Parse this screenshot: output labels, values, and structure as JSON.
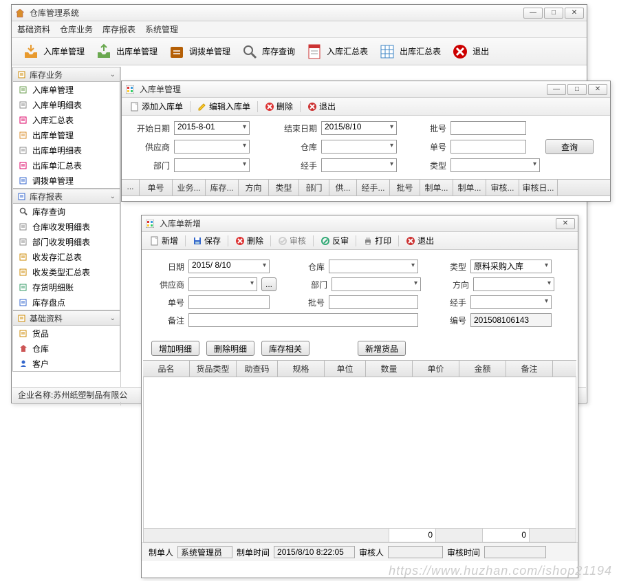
{
  "main": {
    "title": "仓库管理系统",
    "menu": [
      "基础资料",
      "仓库业务",
      "库存报表",
      "系统管理"
    ],
    "toolbar": [
      {
        "label": "入库单管理",
        "icon": "inbox",
        "color": "#e89a2e"
      },
      {
        "label": "出库单管理",
        "icon": "outbox",
        "color": "#6aa84f"
      },
      {
        "label": "调拨单管理",
        "icon": "transfer",
        "color": "#b45f06"
      },
      {
        "label": "库存查询",
        "icon": "search",
        "color": "#666"
      },
      {
        "label": "入库汇总表",
        "icon": "sheet",
        "color": "#cc3333"
      },
      {
        "label": "出库汇总表",
        "icon": "grid",
        "color": "#3d85c6"
      },
      {
        "label": "退出",
        "icon": "close",
        "color": "#cc0000"
      }
    ],
    "accordion": [
      {
        "title": "库存业务",
        "icon": "box",
        "items": [
          {
            "label": "入库单管理",
            "icon": "doc-in"
          },
          {
            "label": "入库单明细表",
            "icon": "doc-list"
          },
          {
            "label": "入库汇总表",
            "icon": "doc-sum"
          },
          {
            "label": "出库单管理",
            "icon": "doc-out"
          },
          {
            "label": "出库单明细表",
            "icon": "doc-list"
          },
          {
            "label": "出库单汇总表",
            "icon": "doc-sum"
          },
          {
            "label": "调拨单管理",
            "icon": "doc-swap"
          }
        ]
      },
      {
        "title": "库存报表",
        "icon": "report",
        "items": [
          {
            "label": "库存查询",
            "icon": "search-sm"
          },
          {
            "label": "仓库收发明细表",
            "icon": "list"
          },
          {
            "label": "部门收发明细表",
            "icon": "list"
          },
          {
            "label": "收发存汇总表",
            "icon": "sum"
          },
          {
            "label": "收发类型汇总表",
            "icon": "sum"
          },
          {
            "label": "存货明细账",
            "icon": "ledger"
          },
          {
            "label": "库存盘点",
            "icon": "check"
          }
        ]
      },
      {
        "title": "基础资料",
        "icon": "base",
        "items": [
          {
            "label": "货品",
            "icon": "goods"
          },
          {
            "label": "仓库",
            "icon": "house"
          },
          {
            "label": "客户",
            "icon": "user"
          }
        ]
      }
    ],
    "status": "企业名称:苏州纸塑制品有限公"
  },
  "mgr": {
    "title": "入库单管理",
    "toolbar": [
      {
        "label": "添加入库单",
        "icon": "new"
      },
      {
        "label": "编辑入库单",
        "icon": "edit"
      },
      {
        "label": "删除",
        "icon": "del"
      },
      {
        "label": "退出",
        "icon": "exit"
      }
    ],
    "filters": {
      "start_label": "开始日期",
      "start_value": "2015-8-01",
      "end_label": "结束日期",
      "end_value": "2015/8/10",
      "batch_label": "批号",
      "supplier_label": "供应商",
      "wh_label": "仓库",
      "no_label": "单号",
      "dept_label": "部门",
      "handler_label": "经手",
      "type_label": "类型",
      "query": "查询"
    },
    "cols": [
      "...",
      "单号",
      "业务...",
      "库存...",
      "方向",
      "类型",
      "部门",
      "供...",
      "经手...",
      "批号",
      "制单...",
      "制单...",
      "审核...",
      "审核日..."
    ]
  },
  "add": {
    "title": "入库单新增",
    "toolbar": [
      {
        "label": "新增",
        "icon": "new"
      },
      {
        "label": "保存",
        "icon": "save"
      },
      {
        "label": "删除",
        "icon": "del"
      },
      {
        "label": "审核",
        "icon": "audit",
        "disabled": true
      },
      {
        "label": "反审",
        "icon": "unaudit"
      },
      {
        "label": "打印",
        "icon": "print"
      },
      {
        "label": "退出",
        "icon": "exit"
      }
    ],
    "fields": {
      "date_label": "日期",
      "date_value": "2015/ 8/10",
      "wh_label": "仓库",
      "type_label": "类型",
      "type_value": "原料采购入库",
      "supplier_label": "供应商",
      "dept_label": "部门",
      "dir_label": "方向",
      "no_label": "单号",
      "batch_label": "批号",
      "handler_label": "经手",
      "remark_label": "备注",
      "code_label": "编号",
      "code_value": "201508106143"
    },
    "buttons": {
      "add_line": "增加明细",
      "del_line": "删除明细",
      "rel": "库存相关",
      "new_goods": "新增货品"
    },
    "cols": [
      "品名",
      "货品类型",
      "助查码",
      "规格",
      "单位",
      "数量",
      "单价",
      "金额",
      "备注"
    ],
    "totals": {
      "qty": "0",
      "amt": "0"
    },
    "footer": {
      "maker_label": "制单人",
      "maker": "系统管理员",
      "mtime_label": "制单时间",
      "mtime": "2015/8/10 8:22:05",
      "auditor_label": "审核人",
      "atime_label": "审核时间"
    }
  },
  "watermark": "https://www.huzhan.com/ishop21194"
}
